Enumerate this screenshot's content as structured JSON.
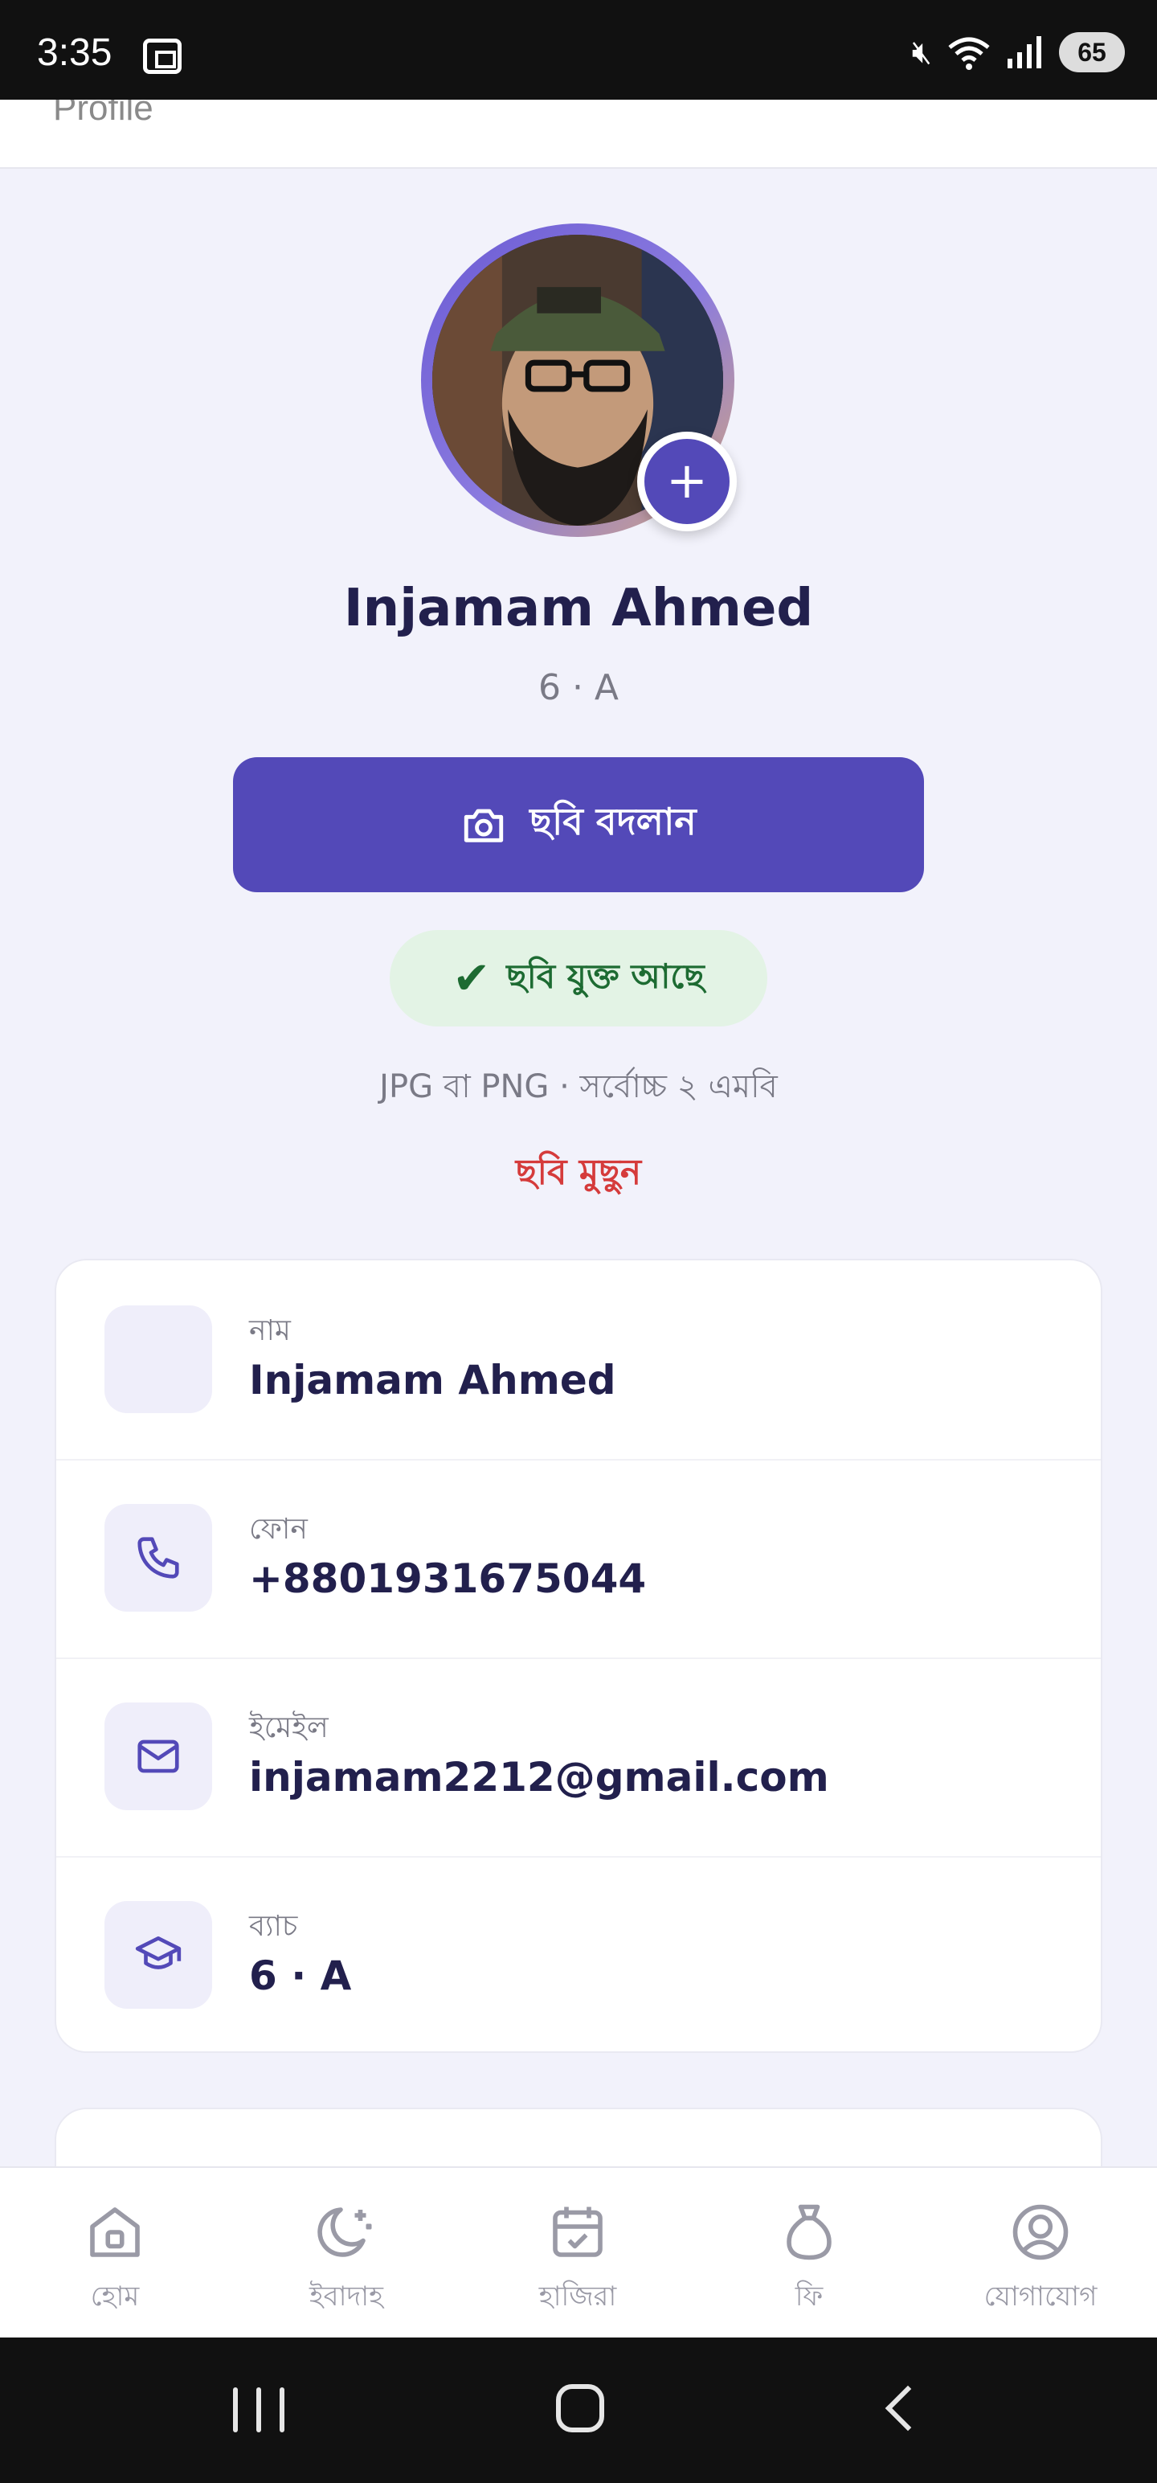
{
  "status_bar": {
    "time": "3:35",
    "battery": "65"
  },
  "header": {
    "title": "Profile"
  },
  "profile": {
    "name": "Injamam Ahmed",
    "class_section": "6 · A",
    "change_photo_label": "ছবি বদলান",
    "photo_status": "ছবি যুক্ত আছে",
    "upload_hint": "JPG বা PNG · সর্বোচ্চ ২ এমবি",
    "delete_photo_label": "ছবি মুছুন"
  },
  "info": {
    "rows": [
      {
        "label": "নাম",
        "value": "Injamam Ahmed",
        "icon": "user-icon"
      },
      {
        "label": "ফোন",
        "value": "+8801931675044",
        "icon": "phone-icon"
      },
      {
        "label": "ইমেইল",
        "value": "injamam2212@gmail.com",
        "icon": "mail-icon"
      },
      {
        "label": "ব্যাচ",
        "value": "6 · A",
        "icon": "graduation-cap-icon"
      }
    ]
  },
  "bottom_nav": {
    "items": [
      {
        "label": "হোম",
        "icon": "home-icon"
      },
      {
        "label": "ইবাদাহ",
        "icon": "moon-star-icon"
      },
      {
        "label": "হাজিরা",
        "icon": "calendar-check-icon"
      },
      {
        "label": "ফি",
        "icon": "money-bag-icon"
      },
      {
        "label": "যোগাযোগ",
        "icon": "user-circle-icon"
      }
    ]
  },
  "colors": {
    "primary": "#5349b8",
    "success_bg": "#e3f3e5",
    "success_text": "#1d6b32",
    "danger": "#d53b3b",
    "page_bg": "#f2f2fb",
    "text_dark": "#22204d"
  }
}
